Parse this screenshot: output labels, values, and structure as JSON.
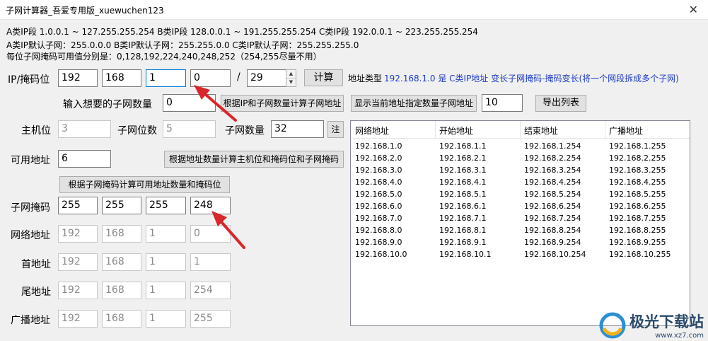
{
  "window": {
    "title": "子网计算器_吾爱专用版_xuewuchen123",
    "close_glyph": "✕"
  },
  "info": {
    "ranges": "A类IP段 1.0.0.1 ~ 127.255.255.254 B类IP段 128.0.0.1 ~ 191.255.255.254 C类IP段 192.0.0.1 ~ 223.255.255.254",
    "defaults": "A类IP默认子网：255.0.0.0 B类IP默认子网：255.255.0.0 C类IP默认子网：255.255.255.0",
    "mask_values": "每位子网掩码可用值分别是：0,128,192,224,240,248,252（254,255尽量不用）"
  },
  "ip_row": {
    "label": "IP/掩码位",
    "octets": [
      "192",
      "168",
      "1",
      "0"
    ],
    "slash": "/",
    "prefix": "29",
    "calc_button": "计算",
    "type_label": "地址类型",
    "type_value": "192.168.1.0 是 C类IP地址 变长子网掩码-掩码变长(将一个网段拆成多个子网)"
  },
  "subnet_row": {
    "label": "输入想要的子网数量",
    "value": "0",
    "calc_button": "根据IP和子网数量计算子网地址",
    "show_button": "显示当前地址指定数量子网地址",
    "show_count": "10",
    "export_button": "导出列表"
  },
  "host_row": {
    "host_label": "主机位",
    "host_value": "3",
    "subnet_bits_label": "子网位数",
    "subnet_bits_value": "5",
    "subnet_count_label": "子网数量",
    "subnet_count_value": "32",
    "note_button": "注"
  },
  "usable_row": {
    "label": "可用地址",
    "value": "6",
    "calc_button": "根据地址数量计算主机位和掩码位和子网掩码"
  },
  "mask_calc_button": "根据子网掩码计算可用地址数量和掩码位",
  "mask_row": {
    "label": "子网掩码",
    "octets": [
      "255",
      "255",
      "255",
      "248"
    ]
  },
  "network_row": {
    "label": "网络地址",
    "octets": [
      "192",
      "168",
      "1",
      "0"
    ]
  },
  "first_row": {
    "label": "首地址",
    "octets": [
      "192",
      "168",
      "1",
      "1"
    ]
  },
  "last_row": {
    "label": "尾地址",
    "octets": [
      "192",
      "168",
      "1",
      "254"
    ]
  },
  "broadcast_row": {
    "label": "广播地址",
    "octets": [
      "192",
      "168",
      "1",
      "255"
    ]
  },
  "table": {
    "columns": [
      "网络地址",
      "开始地址",
      "结束地址",
      "广播地址"
    ],
    "rows": [
      [
        "192.168.1.0",
        "192.168.1.1",
        "192.168.1.254",
        "192.168.1.255"
      ],
      [
        "192.168.2.0",
        "192.168.2.1",
        "192.168.2.254",
        "192.168.2.255"
      ],
      [
        "192.168.3.0",
        "192.168.3.1",
        "192.168.3.254",
        "192.168.3.255"
      ],
      [
        "192.168.4.0",
        "192.168.4.1",
        "192.168.4.254",
        "192.168.4.255"
      ],
      [
        "192.168.5.0",
        "192.168.5.1",
        "192.168.5.254",
        "192.168.5.255"
      ],
      [
        "192.168.6.0",
        "192.168.6.1",
        "192.168.6.254",
        "192.168.6.255"
      ],
      [
        "192.168.7.0",
        "192.168.7.1",
        "192.168.7.254",
        "192.168.7.255"
      ],
      [
        "192.168.8.0",
        "192.168.8.1",
        "192.168.8.254",
        "192.168.8.255"
      ],
      [
        "192.168.9.0",
        "192.168.9.1",
        "192.168.9.254",
        "192.168.9.255"
      ],
      [
        "192.168.10.0",
        "192.168.10.1",
        "192.168.10.254",
        "192.168.10.255"
      ]
    ]
  },
  "watermark": {
    "text": "极光下载站",
    "url": "www.xz7.com"
  },
  "colors": {
    "accent": "#1e3cc8",
    "arrow": "#d9262b",
    "focus": "#0078d7"
  }
}
